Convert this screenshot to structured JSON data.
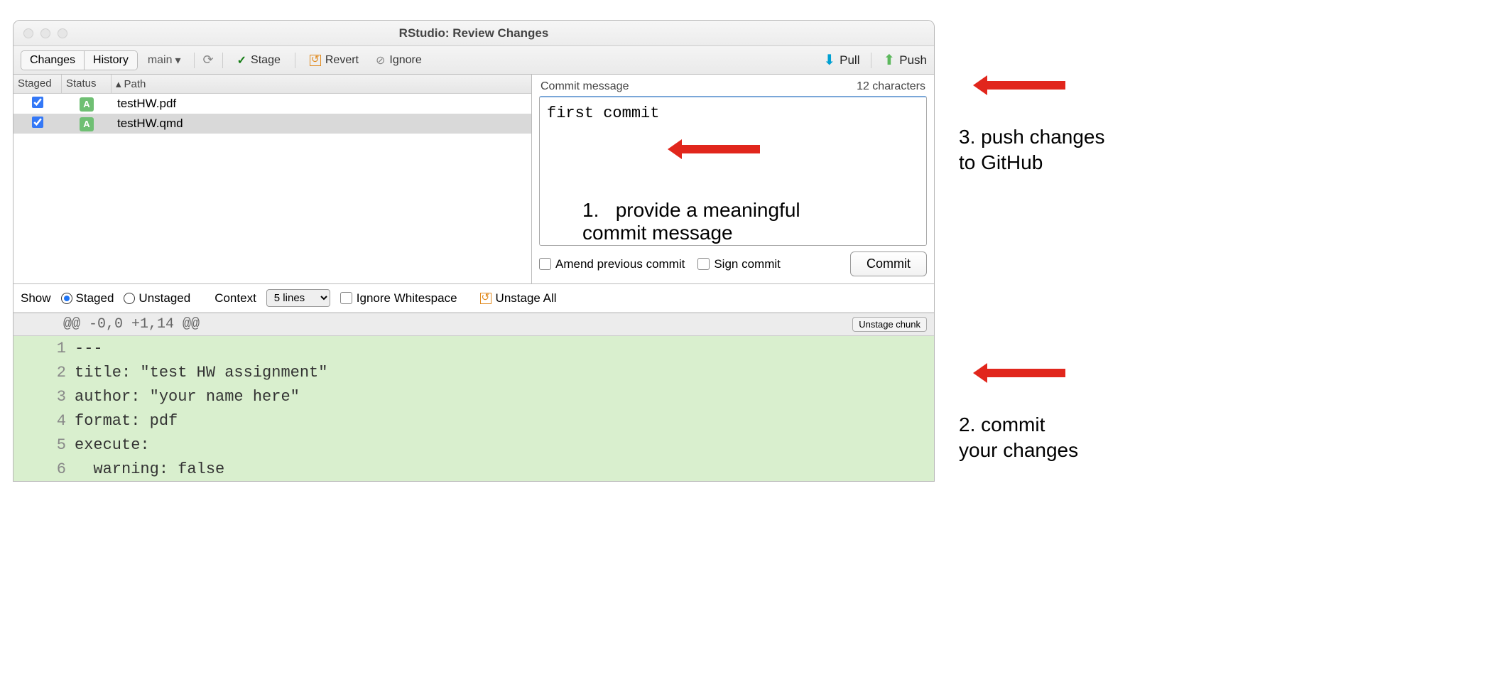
{
  "window": {
    "title": "RStudio: Review Changes"
  },
  "toolbar": {
    "changes": "Changes",
    "history": "History",
    "branch": "main",
    "stage": "Stage",
    "revert": "Revert",
    "ignore": "Ignore",
    "pull": "Pull",
    "push": "Push"
  },
  "file_header": {
    "staged": "Staged",
    "status": "Status",
    "path": "Path"
  },
  "files": [
    {
      "staged": true,
      "status": "A",
      "path": "testHW.pdf",
      "selected": false
    },
    {
      "staged": true,
      "status": "A",
      "path": "testHW.qmd",
      "selected": true
    }
  ],
  "commit": {
    "label": "Commit message",
    "counter": "12 characters",
    "message": "first commit",
    "amend": "Amend previous commit",
    "sign": "Sign commit",
    "button": "Commit"
  },
  "diff_toolbar": {
    "show": "Show",
    "staged": "Staged",
    "unstaged": "Unstaged",
    "context_label": "Context",
    "context_value": "5 lines",
    "ignore_ws": "Ignore Whitespace",
    "unstage_all": "Unstage All"
  },
  "hunk": {
    "header": "@@ -0,0 +1,14 @@",
    "unstage_chunk": "Unstage chunk",
    "lines": [
      {
        "num": "1",
        "text": "---"
      },
      {
        "num": "2",
        "text": "title: \"test HW assignment\""
      },
      {
        "num": "3",
        "text": "author: \"your name here\""
      },
      {
        "num": "4",
        "text": "format: pdf"
      },
      {
        "num": "5",
        "text": "execute:"
      },
      {
        "num": "6",
        "text": "  warning: false"
      }
    ]
  },
  "annotations": {
    "step1": "1.   provide a meaningful\ncommit message",
    "step2": "2. commit\nyour changes",
    "step3": "3. push changes\nto GitHub"
  }
}
